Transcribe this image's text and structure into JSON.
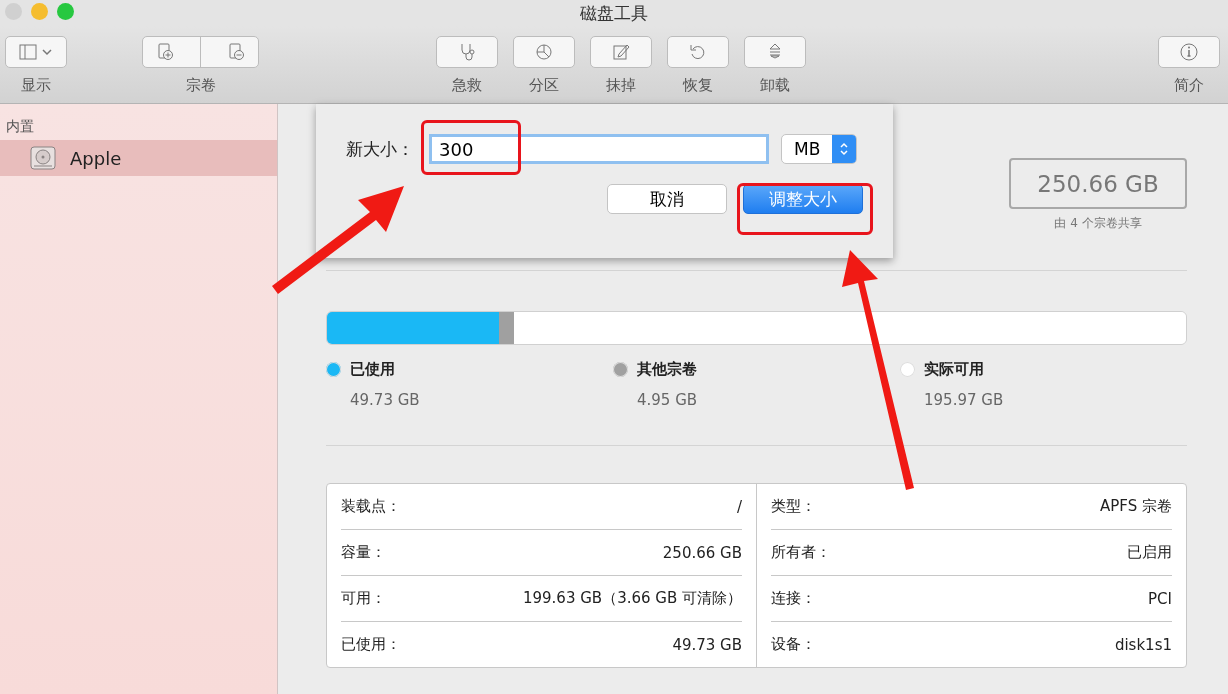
{
  "window": {
    "title": "磁盘工具"
  },
  "toolbar": {
    "left": [
      {
        "label": "显示",
        "kind": "view"
      },
      {
        "label": "宗卷",
        "kind": "pair"
      }
    ],
    "center": [
      {
        "label": "急救",
        "kind": "firstaid"
      },
      {
        "label": "分区",
        "kind": "partition"
      },
      {
        "label": "抹掉",
        "kind": "erase"
      },
      {
        "label": "恢复",
        "kind": "restore"
      },
      {
        "label": "卸载",
        "kind": "unmount"
      }
    ],
    "right": [
      {
        "label": "简介",
        "kind": "info"
      }
    ]
  },
  "sidebar": {
    "section": "内置",
    "items": [
      {
        "label": "Apple",
        "selected": true
      }
    ]
  },
  "dialog": {
    "size_label": "新大小：",
    "value": "300",
    "unit": "MB",
    "cancel": "取消",
    "confirm": "调整大小"
  },
  "capacity": {
    "value": "250.66 GB",
    "note": "由 4 个宗卷共享"
  },
  "usage": [
    {
      "name": "已使用",
      "value": "49.73 GB",
      "color": "#1ab8f5",
      "level": 0.2
    },
    {
      "name": "其他宗卷",
      "value": "4.95 GB",
      "color": "#a0a0a0",
      "level": 0.018
    },
    {
      "name": "实际可用",
      "value": "195.97 GB",
      "color": "#ffffff",
      "level": 0.782
    }
  ],
  "info": {
    "left": [
      {
        "label": "装载点：",
        "value": "/"
      },
      {
        "label": "容量：",
        "value": "250.66 GB"
      },
      {
        "label": "可用：",
        "value": "199.63 GB（3.66 GB 可清除）"
      },
      {
        "label": "已使用：",
        "value": "49.73 GB"
      }
    ],
    "right": [
      {
        "label": "类型：",
        "value": "APFS 宗卷"
      },
      {
        "label": "所有者：",
        "value": "已启用"
      },
      {
        "label": "连接：",
        "value": "PCI"
      },
      {
        "label": "设备：",
        "value": "disk1s1"
      }
    ]
  }
}
